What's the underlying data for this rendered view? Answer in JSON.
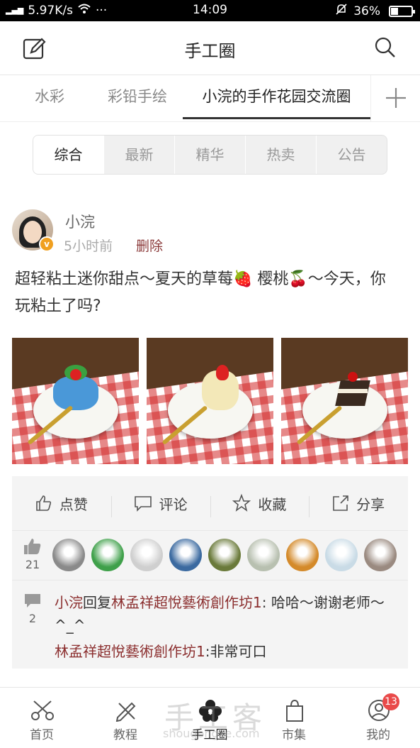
{
  "status_bar": {
    "signal": "4G",
    "speed": "5.97K/s",
    "time": "14:09",
    "battery": "36%",
    "battery_level": 0.36,
    "dots": "···"
  },
  "header": {
    "title": "手工圈"
  },
  "tabs": [
    {
      "label": "水彩"
    },
    {
      "label": "彩铅手绘"
    },
    {
      "label": "小浣的手作花园交流圈",
      "active": true
    }
  ],
  "segments": [
    {
      "label": "综合",
      "active": true
    },
    {
      "label": "最新"
    },
    {
      "label": "精华"
    },
    {
      "label": "热卖"
    },
    {
      "label": "公告"
    }
  ],
  "post": {
    "username": "小浣",
    "time": "5小时前",
    "delete_label": "删除",
    "badge": "v",
    "text": "超轻粘土迷你甜点〜夏天的草莓🍓 樱桃🍒〜今天，你玩粘土了吗?"
  },
  "actions": [
    {
      "label": "点赞",
      "icon": "thumb-up-icon"
    },
    {
      "label": "评论",
      "icon": "comment-icon"
    },
    {
      "label": "收藏",
      "icon": "star-icon"
    },
    {
      "label": "分享",
      "icon": "share-icon"
    }
  ],
  "likes": {
    "count": "21",
    "avatar_colors": [
      "#8a8a8a",
      "#3fa04a",
      "#cfcfcf",
      "#3b6aa0",
      "#6a7a3a",
      "#b8c0b0",
      "#d48a2a",
      "#c9dbe6",
      "#9a8a80"
    ]
  },
  "comments": {
    "count": "2",
    "items": [
      {
        "user": "小浣",
        "reply_word": "回复",
        "target": "林孟祥超悅藝術創作坊1",
        "text": ": 哈哈〜谢谢老师〜^_^"
      },
      {
        "user": "林孟祥超悅藝術創作坊1",
        "text": ":非常可口"
      }
    ]
  },
  "bottom_nav": [
    {
      "label": "首页",
      "icon": "scissors-icon"
    },
    {
      "label": "教程",
      "icon": "pencil-ruler-icon"
    },
    {
      "label": "手工圈",
      "icon": "flower-icon",
      "active": true
    },
    {
      "label": "市集",
      "icon": "bag-icon"
    },
    {
      "label": "我的",
      "icon": "user-icon",
      "badge": "13"
    }
  ],
  "watermark": {
    "text": "手工客",
    "url": "shougongke.com"
  },
  "colors": {
    "accent_red": "#8b2e2e",
    "badge_red": "#e94a4a",
    "verified": "#f0a020"
  }
}
